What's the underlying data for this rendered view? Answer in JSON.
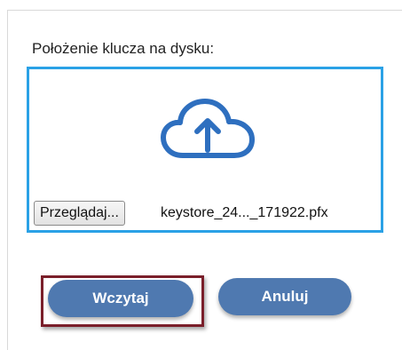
{
  "key_location_label": "Położenie klucza na dysku:",
  "dropzone": {
    "icon": "cloud-upload-icon",
    "accent_color": "#2aa1e6",
    "browse_label": "Przeglądaj...",
    "file_name": "keystore_24..._171922.pfx"
  },
  "buttons": {
    "load_label": "Wczytaj",
    "cancel_label": "Anuluj",
    "button_color": "#4f79b0",
    "focus_color": "#7a1f2a"
  }
}
